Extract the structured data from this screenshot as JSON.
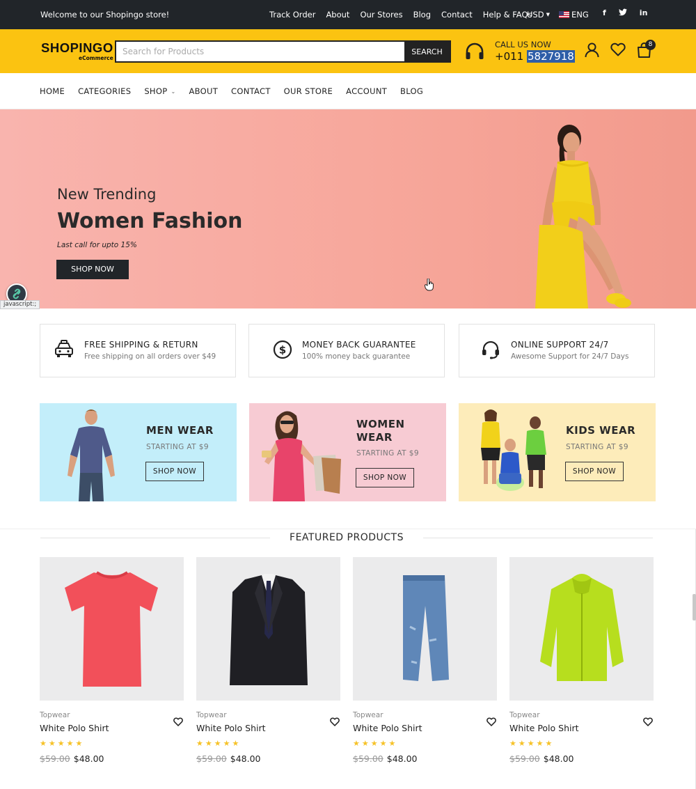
{
  "topbar": {
    "welcome": "Welcome to our Shopingo store!",
    "links": [
      "Track Order",
      "About",
      "Our Stores",
      "Blog",
      "Contact",
      "Help & FAQs"
    ],
    "currency": "USD",
    "language": "ENG",
    "social": [
      "f",
      "t",
      "in"
    ]
  },
  "header": {
    "brand": "SHOPINGO",
    "brand_sub": "eCommerce",
    "search_placeholder": "Search for Products",
    "search_button": "SEARCH",
    "call_label": "CALL US NOW",
    "call_prefix": "+011",
    "call_number": "5827918",
    "cart_count": "8"
  },
  "nav": {
    "items": [
      "HOME",
      "CATEGORIES",
      "SHOP",
      "ABOUT",
      "CONTACT",
      "OUR STORE",
      "ACCOUNT",
      "BLOG"
    ]
  },
  "hero": {
    "subtitle": "New Trending",
    "title": "Women Fashion",
    "note": "Last call for upto 15%",
    "button": "SHOP NOW"
  },
  "status_url": "javascript:;",
  "features": [
    {
      "title": "FREE SHIPPING & RETURN",
      "desc": "Free shipping on all orders over $49",
      "icon": "taxi-icon"
    },
    {
      "title": "MONEY BACK GUARANTEE",
      "desc": "100% money back guarantee",
      "icon": "dollar-circle-icon"
    },
    {
      "title": "ONLINE SUPPORT 24/7",
      "desc": "Awesome Support for 24/7 Days",
      "icon": "headset-icon"
    }
  ],
  "categories": [
    {
      "title": "MEN WEAR",
      "starting": "STARTING AT $9",
      "button": "SHOP NOW",
      "bg": "#c3eefa"
    },
    {
      "title_line1": "WOMEN",
      "title_line2": "WEAR",
      "starting": "STARTING AT $9",
      "button": "SHOP NOW",
      "bg": "#f7cbd3"
    },
    {
      "title": "KIDS WEAR",
      "starting": "STARTING AT $9",
      "button": "SHOP NOW",
      "bg": "#fdecba"
    }
  ],
  "featured": {
    "title": "FEATURED PRODUCTS",
    "products": [
      {
        "category": "Topwear",
        "name": "White Polo Shirt",
        "rating": 5,
        "stars": "★★★★★",
        "old_price": "$59.00",
        "price": "$48.00"
      },
      {
        "category": "Topwear",
        "name": "White Polo Shirt",
        "rating": 5,
        "stars": "★★★★★",
        "old_price": "$59.00",
        "price": "$48.00"
      },
      {
        "category": "Topwear",
        "name": "White Polo Shirt",
        "rating": 5,
        "stars": "★★★★★",
        "old_price": "$59.00",
        "price": "$48.00"
      },
      {
        "category": "Topwear",
        "name": "White Polo Shirt",
        "rating": 5,
        "stars": "★★★★★",
        "old_price": "$59.00",
        "price": "$48.00"
      }
    ]
  },
  "colors": {
    "accent": "#fbc311",
    "dark": "#212529",
    "hero_bg": "#f7a79b",
    "star": "#f6c227"
  }
}
